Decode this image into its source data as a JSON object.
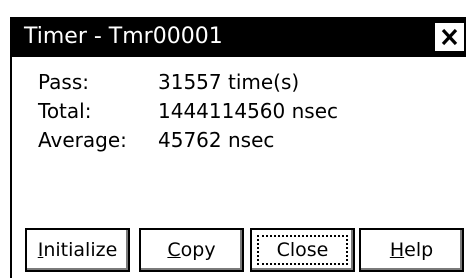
{
  "window": {
    "title": "Timer - Tmr00001",
    "close_glyph": "✕"
  },
  "stats": {
    "pass_label": "Pass:",
    "pass_value": "31557 time(s)",
    "total_label": "Total:",
    "total_value": "1444114560 nsec",
    "average_label": "Average:",
    "average_value": "45762 nsec"
  },
  "buttons": {
    "initialize": {
      "mnemonic": "I",
      "rest": "nitialize"
    },
    "copy": {
      "mnemonic": "C",
      "rest": "opy"
    },
    "close": {
      "text": "Close"
    },
    "help": {
      "mnemonic": "H",
      "rest": "elp"
    }
  },
  "colors": {
    "titlebar": "#000000",
    "background": "#ffffff",
    "text": "#000000"
  }
}
